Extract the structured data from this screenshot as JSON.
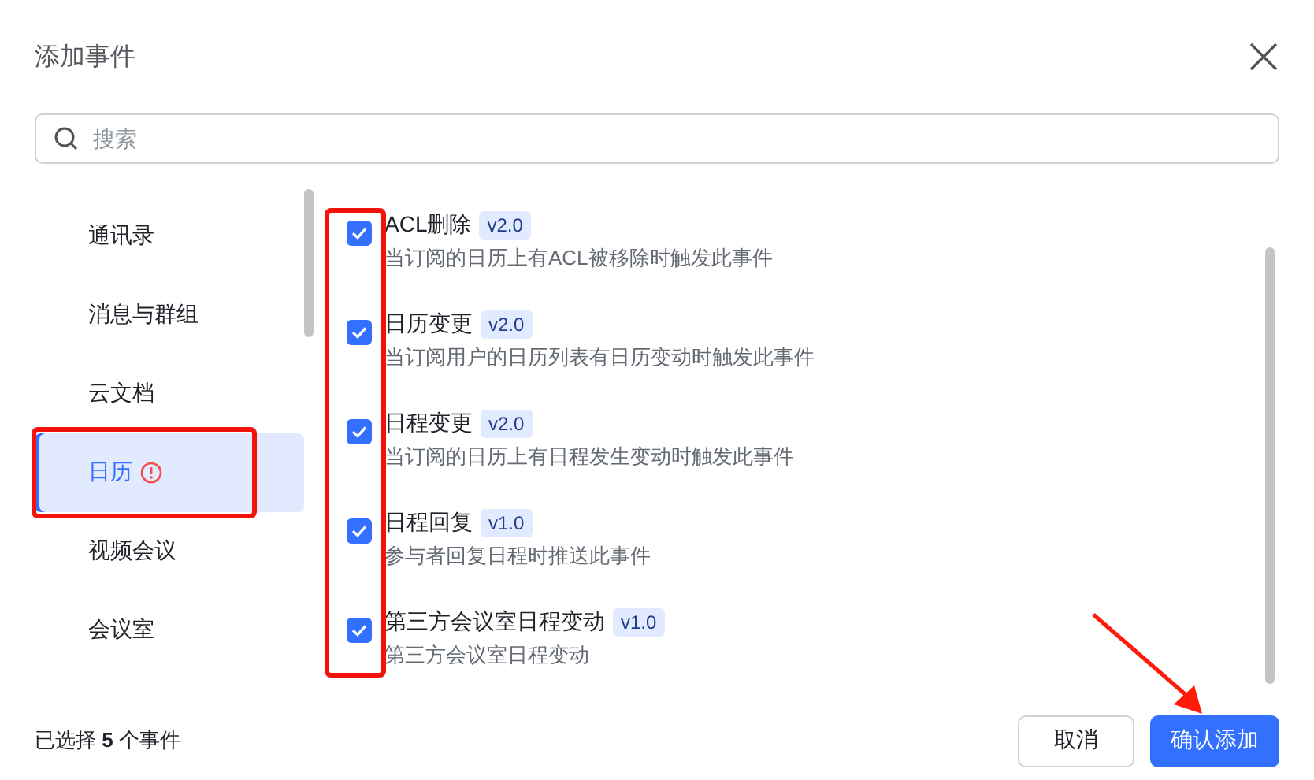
{
  "dialog": {
    "title": "添加事件"
  },
  "search": {
    "placeholder": "搜索"
  },
  "categories": [
    {
      "label": "通讯录",
      "selected": false,
      "warning": false
    },
    {
      "label": "消息与群组",
      "selected": false,
      "warning": false
    },
    {
      "label": "云文档",
      "selected": false,
      "warning": false
    },
    {
      "label": "日历",
      "selected": true,
      "warning": true
    },
    {
      "label": "视频会议",
      "selected": false,
      "warning": false
    },
    {
      "label": "会议室",
      "selected": false,
      "warning": false
    }
  ],
  "events": [
    {
      "name": "ACL删除",
      "version": "v2.0",
      "description": "当订阅的日历上有ACL被移除时触发此事件",
      "checked": true
    },
    {
      "name": "日历变更",
      "version": "v2.0",
      "description": "当订阅用户的日历列表有日历变动时触发此事件",
      "checked": true
    },
    {
      "name": "日程变更",
      "version": "v2.0",
      "description": "当订阅的日历上有日程发生变动时触发此事件",
      "checked": true
    },
    {
      "name": "日程回复",
      "version": "v1.0",
      "description": "参与者回复日程时推送此事件",
      "checked": true
    },
    {
      "name": "第三方会议室日程变动",
      "version": "v1.0",
      "description": "第三方会议室日程变动",
      "checked": true
    }
  ],
  "footer": {
    "selection_summary": "已选择 **5** 个事件",
    "buttons": [
      {
        "label": "取消",
        "kind": "secondary"
      },
      {
        "label": "确认添加",
        "kind": "primary"
      }
    ]
  },
  "annotations": {
    "frame_selected_category": true,
    "frame_checkboxes": true,
    "arrow_to_confirm": true
  }
}
